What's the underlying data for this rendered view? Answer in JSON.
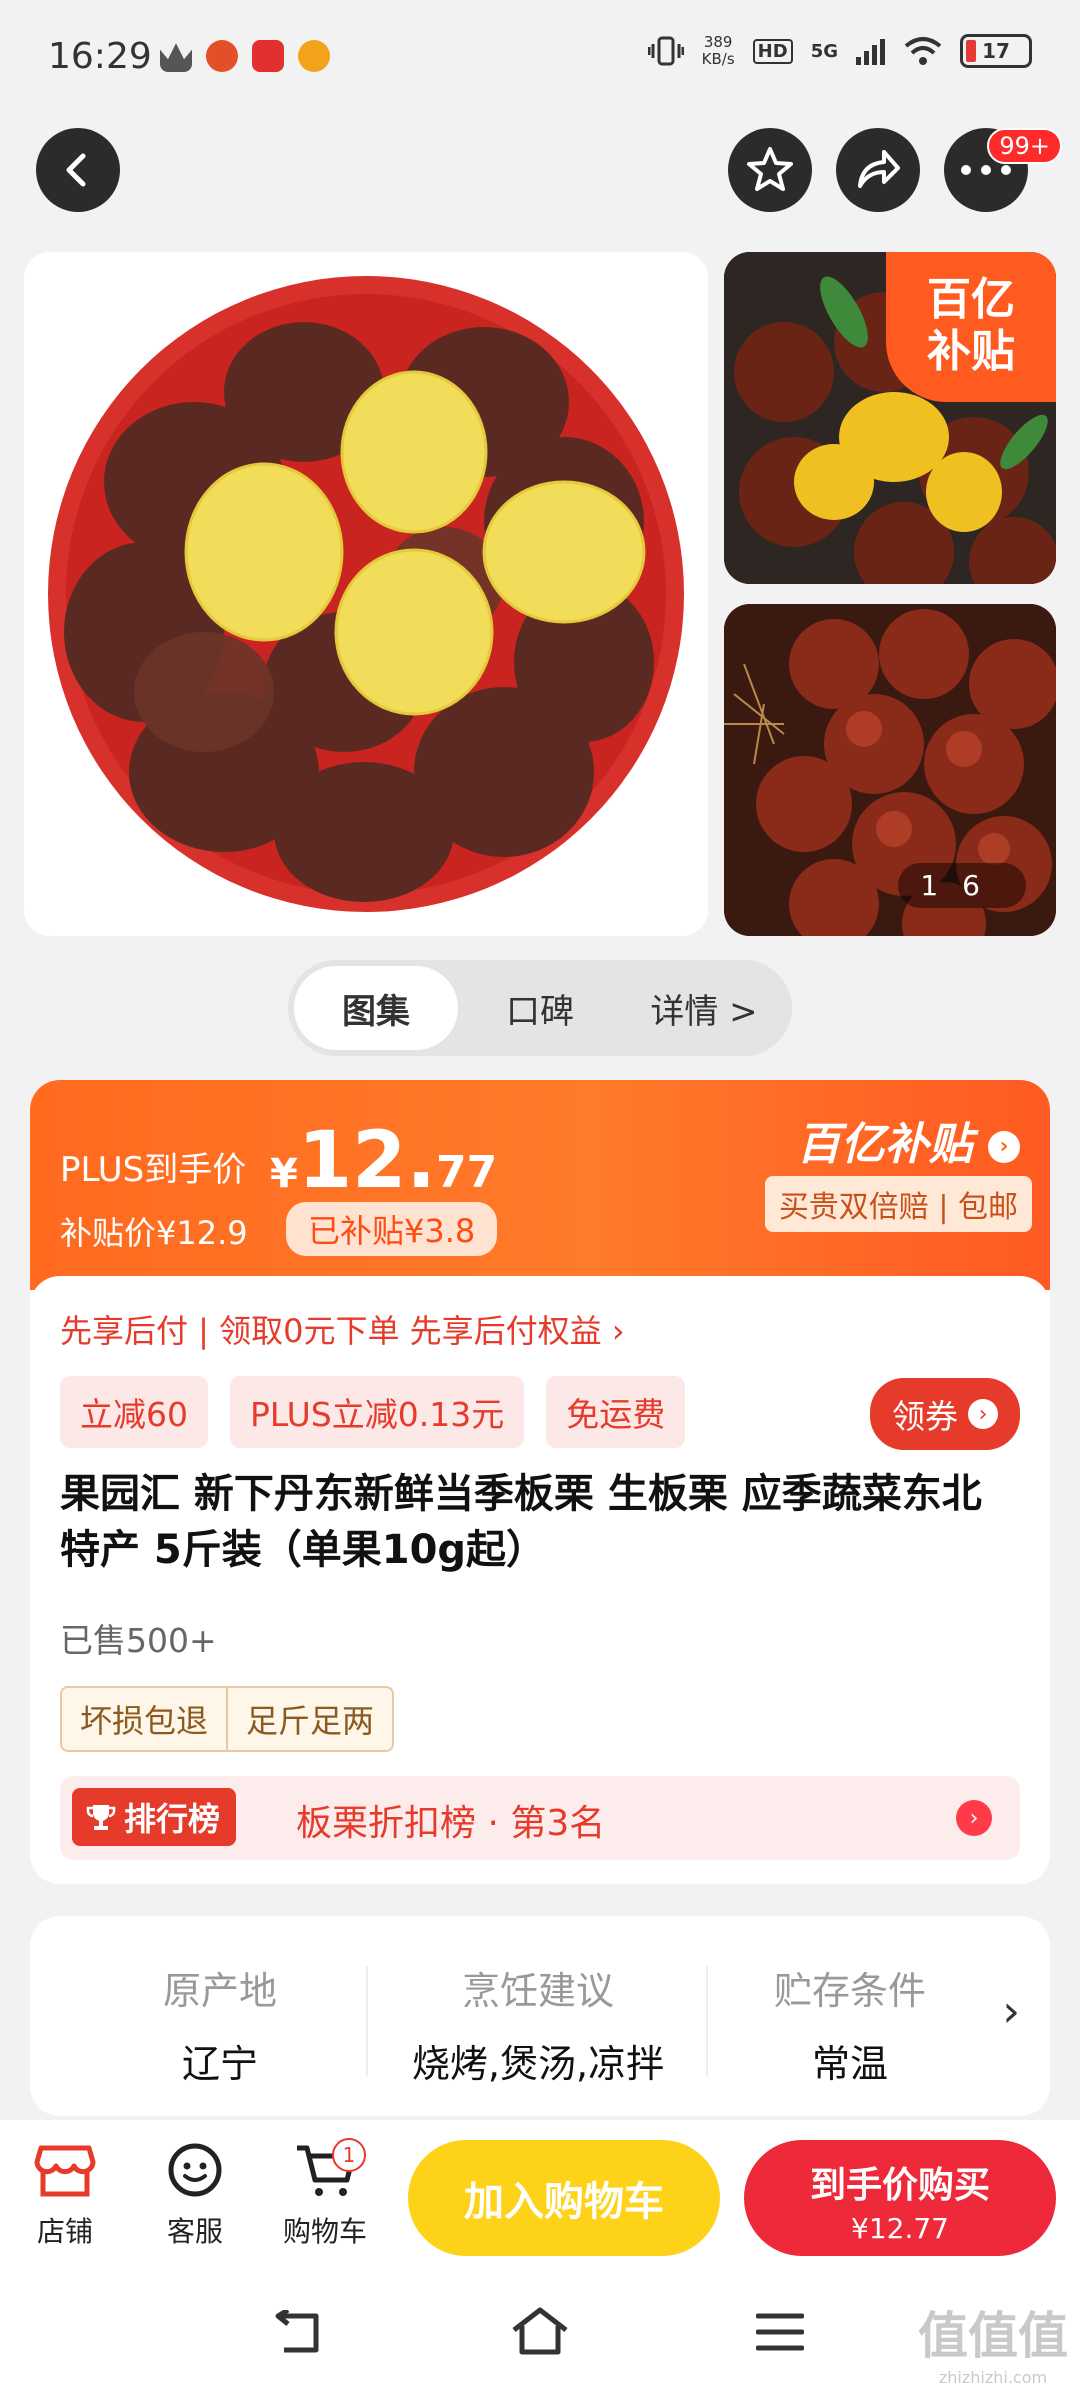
{
  "status_bar": {
    "time": "16:29",
    "net_speed_value": "389",
    "net_speed_unit": "KB/s",
    "hd": "HD",
    "network": "5G",
    "battery": "17"
  },
  "nav": {
    "more_badge": "99+"
  },
  "gallery": {
    "subsidy_corner_line1": "百亿",
    "subsidy_corner_line2": "补贴",
    "pager_current": "1",
    "pager_total": "6",
    "tabs": [
      {
        "label": "图集",
        "active": true
      },
      {
        "label": "口碑",
        "active": false
      },
      {
        "label": "详情 >",
        "active": false
      }
    ]
  },
  "price": {
    "plus_label": "PLUS到手价",
    "currency": "¥",
    "price_int": "12.",
    "price_dec": "77",
    "subsidy_price": "补贴价¥12.9",
    "subsidized_badge": "已补贴¥3.8",
    "brand": "百亿补贴",
    "brand_sub": "买贵双倍赔 | 包邮"
  },
  "promo": {
    "pay_later": "先享后付 | 领取0元下单 先享后付权益 ›",
    "chips": [
      "立减60",
      "PLUS立减0.13元",
      "免运费"
    ],
    "coupon": "领券"
  },
  "product": {
    "title": "果园汇 新下丹东新鲜当季板栗 生板栗 应季蔬菜东北特产 5斤装（单果10g起）",
    "sold": "已售500+",
    "assurances": [
      "坏损包退",
      "足斤足两"
    ],
    "rank_tag": "排行榜",
    "rank_text": "板栗折扣榜 · 第3名"
  },
  "attributes": [
    {
      "key": "原产地",
      "value": "辽宁"
    },
    {
      "key": "烹饪建议",
      "value": "烧烤,煲汤,凉拌"
    },
    {
      "key": "贮存条件",
      "value": "常温"
    }
  ],
  "bottom": {
    "shop": "店铺",
    "service": "客服",
    "cart": "购物车",
    "cart_count": "1",
    "add_to_cart": "加入购物车",
    "buy_line1": "到手价购买",
    "buy_line2": "¥12.77"
  },
  "watermark": {
    "main": "值值值",
    "sub": "zhizhizhi.com"
  },
  "colors": {
    "accent_orange": "#ff6a1f",
    "accent_red": "#e63a2a",
    "cart_yellow": "#ffd21a"
  }
}
